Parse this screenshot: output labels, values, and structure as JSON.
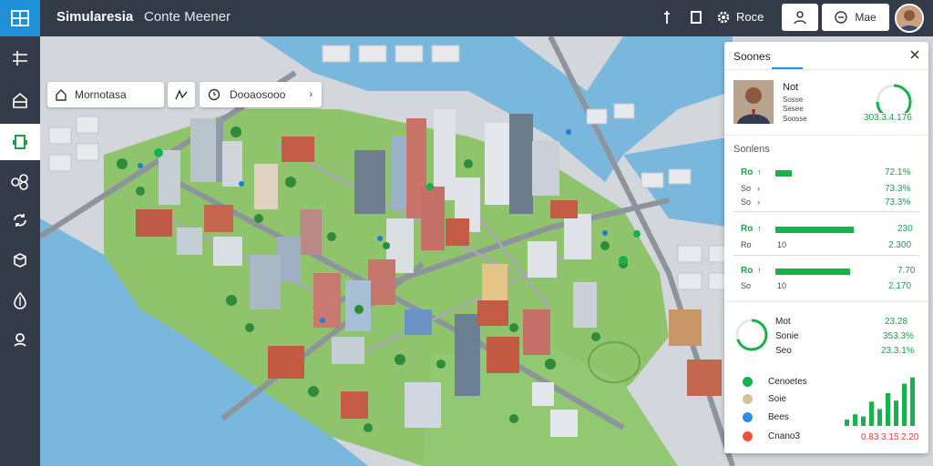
{
  "topbar": {
    "title": "Simularesia",
    "subtitle": "Conte Meener",
    "right_text": "Roce",
    "btn_right_label": "Mae"
  },
  "map_toolbar": {
    "left_pill_text": "Mornotasa",
    "mid_pill_text": "Dooaosooo"
  },
  "panel": {
    "title": "Soones",
    "profile": {
      "name": "Not",
      "line2": "Sosse",
      "line3": "Sesee",
      "line4": "Soosse",
      "value": "303.3.4.176",
      "gauge_fraction": 0.75
    },
    "section_title": "Sonlens",
    "rows": [
      {
        "label": "Ro",
        "sub": "So",
        "bar_fraction": 0.18,
        "value": "72.1%",
        "value2": "73.3%"
      },
      {
        "label": "So",
        "sub": "",
        "bar_fraction": 0.0,
        "value": "",
        "value2": "73.3%"
      },
      {
        "label": "Ro",
        "sub": "Ro",
        "bar_fraction": 0.86,
        "value": "230",
        "value2": "2.300"
      },
      {
        "label": "Ro",
        "sub": "So",
        "bar_fraction": 0.82,
        "value": "7.70",
        "value2": "2.170"
      }
    ],
    "row_sub_nums": [
      "10",
      "10"
    ],
    "stats": {
      "label1": "Mot",
      "label2": "Sonie",
      "label3": "Seo",
      "value1": "23.28",
      "value2": "353.3%",
      "value3": "23.3.1%",
      "ring_fraction": 0.7
    },
    "legend": [
      {
        "label": "Cenoetes",
        "color": "#16b24b"
      },
      {
        "label": "Soie",
        "color": "#d7c48f"
      },
      {
        "label": "Bees",
        "color": "#2a8fe0"
      },
      {
        "label": "Cnano3",
        "color": "#e8553b"
      }
    ],
    "legend_values": {
      "red": "0.83",
      "red2": "3.15",
      "red3": "2.20"
    },
    "mini_bars": [
      0.12,
      0.22,
      0.18,
      0.46,
      0.32,
      0.62,
      0.48,
      0.8,
      0.92
    ]
  },
  "colors": {
    "water": "#7ab7dc",
    "green": "#8fc36c",
    "accent": "#1f8fd8",
    "bar": "#16b24b"
  }
}
